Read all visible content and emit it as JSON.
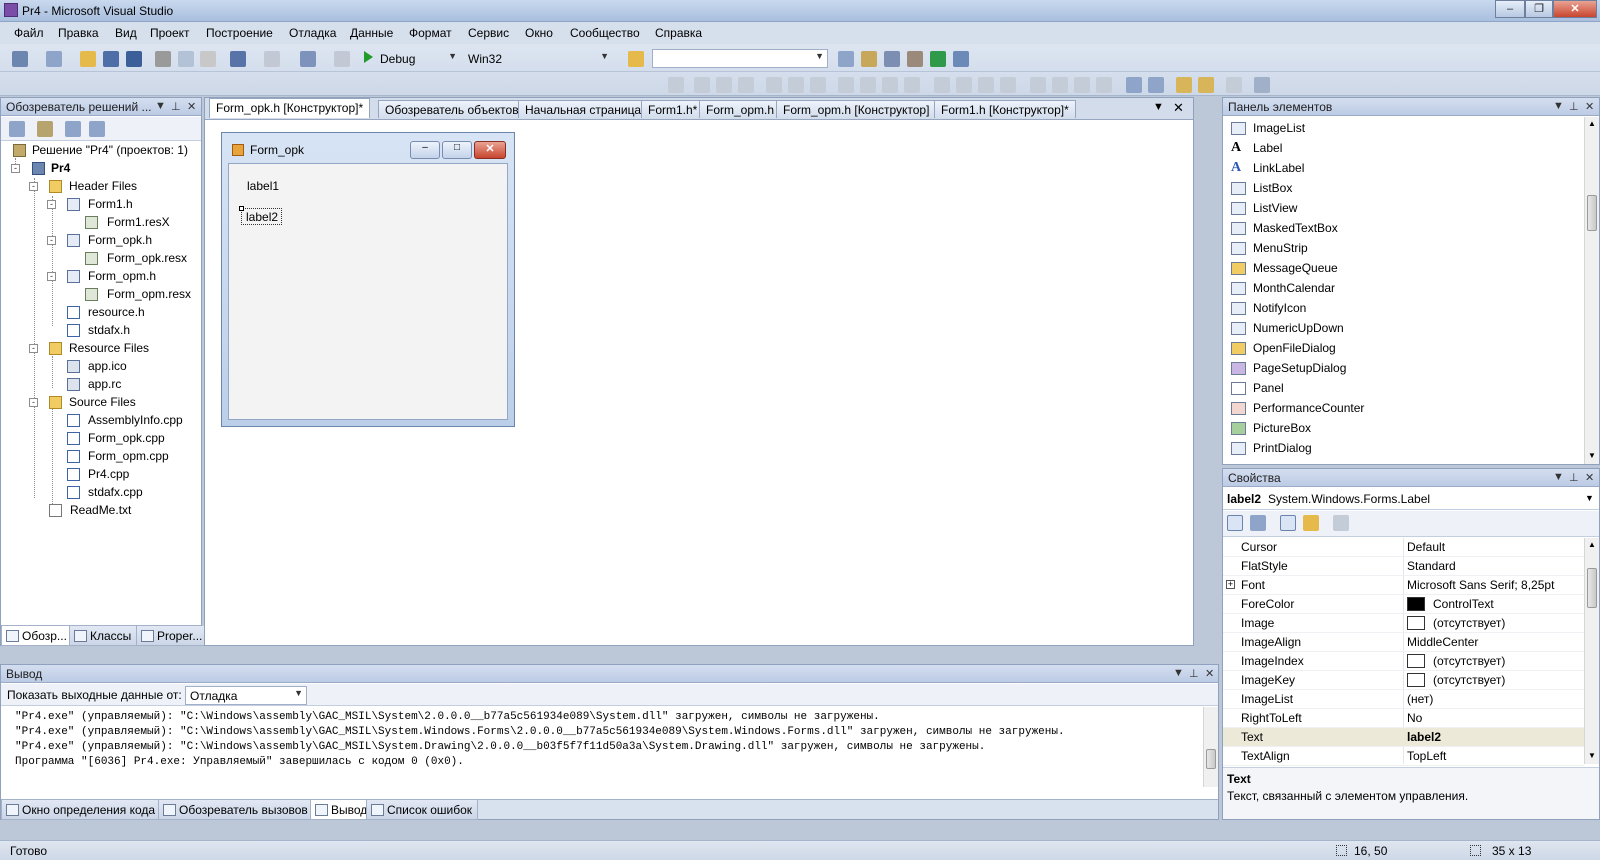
{
  "window": {
    "title": "Pr4 - Microsoft Visual Studio"
  },
  "menu": [
    "Файл",
    "Правка",
    "Вид",
    "Проект",
    "Построение",
    "Отладка",
    "Данные",
    "Формат",
    "Сервис",
    "Окно",
    "Сообщество",
    "Справка"
  ],
  "toolbar": {
    "config": "Debug",
    "platform": "Win32",
    "find": ""
  },
  "solution_explorer": {
    "title": "Обозреватель решений ...",
    "items": [
      {
        "label": "Решение \"Pr4\"  (проектов: 1)"
      },
      {
        "label": "Pr4"
      },
      {
        "label": "Header Files"
      },
      {
        "label": "Form1.h"
      },
      {
        "label": "Form1.resX"
      },
      {
        "label": "Form_opk.h"
      },
      {
        "label": "Form_opk.resx"
      },
      {
        "label": "Form_opm.h"
      },
      {
        "label": "Form_opm.resx"
      },
      {
        "label": "resource.h"
      },
      {
        "label": "stdafx.h"
      },
      {
        "label": "Resource Files"
      },
      {
        "label": "app.ico"
      },
      {
        "label": "app.rc"
      },
      {
        "label": "Source Files"
      },
      {
        "label": "AssemblyInfo.cpp"
      },
      {
        "label": "Form_opk.cpp"
      },
      {
        "label": "Form_opm.cpp"
      },
      {
        "label": "Pr4.cpp"
      },
      {
        "label": "stdafx.cpp"
      },
      {
        "label": "ReadMe.txt"
      }
    ],
    "tabs": [
      "Обозр...",
      "Классы",
      "Proper..."
    ]
  },
  "doc_tabs": [
    "Form_opk.h [Конструктор]*",
    "Обозреватель объектов",
    "Начальная страница",
    "Form1.h*",
    "Form_opm.h",
    "Form_opm.h [Конструктор]",
    "Form1.h [Конструктор]*"
  ],
  "designer": {
    "form_title": "Form_opk",
    "label1": "label1",
    "label2": "label2"
  },
  "toolbox": {
    "title": "Панель элементов",
    "items": [
      "ImageList",
      "Label",
      "LinkLabel",
      "ListBox",
      "ListView",
      "MaskedTextBox",
      "MenuStrip",
      "MessageQueue",
      "MonthCalendar",
      "NotifyIcon",
      "NumericUpDown",
      "OpenFileDialog",
      "PageSetupDialog",
      "Panel",
      "PerformanceCounter",
      "PictureBox",
      "PrintDialog"
    ]
  },
  "properties": {
    "title": "Свойства",
    "object_name": "label2",
    "object_type": "System.Windows.Forms.Label",
    "rows": [
      {
        "name": "Cursor",
        "value": "Default"
      },
      {
        "name": "FlatStyle",
        "value": "Standard"
      },
      {
        "name": "Font",
        "value": "Microsoft Sans Serif; 8,25pt"
      },
      {
        "name": "ForeColor",
        "value": "ControlText"
      },
      {
        "name": "Image",
        "value": "(отсутствует)"
      },
      {
        "name": "ImageAlign",
        "value": "MiddleCenter"
      },
      {
        "name": "ImageIndex",
        "value": "(отсутствует)"
      },
      {
        "name": "ImageKey",
        "value": "(отсутствует)"
      },
      {
        "name": "ImageList",
        "value": "(нет)"
      },
      {
        "name": "RightToLeft",
        "value": "No"
      },
      {
        "name": "Text",
        "value": "label2"
      },
      {
        "name": "TextAlign",
        "value": "TopLeft"
      }
    ],
    "desc_title": "Text",
    "desc_text": "Текст, связанный с элементом управления."
  },
  "output": {
    "title": "Вывод",
    "show_from_label": "Показать выходные данные от:",
    "show_from_value": "Отладка",
    "lines": [
      "\"Pr4.exe\" (управляемый): \"C:\\Windows\\assembly\\GAC_MSIL\\System\\2.0.0.0__b77a5c561934e089\\System.dll\" загружен, символы не загружены.",
      "\"Pr4.exe\" (управляемый): \"C:\\Windows\\assembly\\GAC_MSIL\\System.Windows.Forms\\2.0.0.0__b77a5c561934e089\\System.Windows.Forms.dll\" загружен, символы не загружены.",
      "\"Pr4.exe\" (управляемый): \"C:\\Windows\\assembly\\GAC_MSIL\\System.Drawing\\2.0.0.0__b03f5f7f11d50a3a\\System.Drawing.dll\" загружен, символы не загружены.",
      "Программа \"[6036] Pr4.exe: Управляемый\" завершилась с кодом 0 (0x0)."
    ],
    "tabs": [
      "Окно определения кода",
      "Обозреватель вызовов",
      "Вывод",
      "Список ошибок"
    ]
  },
  "status": {
    "text": "Готово",
    "position": "16, 50",
    "size": "35 x 13"
  }
}
